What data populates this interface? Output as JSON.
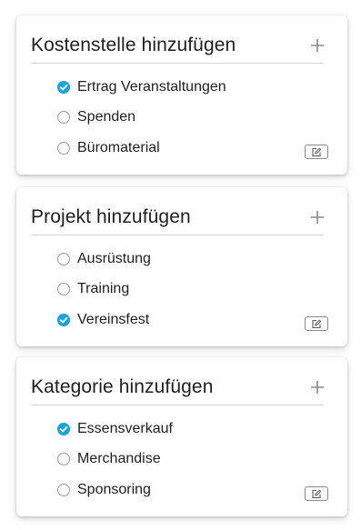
{
  "colors": {
    "accent": "#1aa3d9",
    "text": "#1f1f1f",
    "divider": "#d6d6d6",
    "icon": "#8a8a8a"
  },
  "icons": {
    "add": "plus-icon",
    "edit": "edit-icon",
    "checked": "check-icon"
  },
  "cards": [
    {
      "title": "Kostenstelle hinzufügen",
      "options": [
        {
          "label": "Ertrag Veranstaltungen",
          "checked": true
        },
        {
          "label": "Spenden",
          "checked": false
        },
        {
          "label": "Büromaterial",
          "checked": false
        }
      ]
    },
    {
      "title": "Projekt hinzufügen",
      "options": [
        {
          "label": "Ausrüstung",
          "checked": false
        },
        {
          "label": "Training",
          "checked": false
        },
        {
          "label": "Vereinsfest",
          "checked": true
        }
      ]
    },
    {
      "title": "Kategorie hinzufügen",
      "options": [
        {
          "label": "Essensverkauf",
          "checked": true
        },
        {
          "label": "Merchandise",
          "checked": false
        },
        {
          "label": "Sponsoring",
          "checked": false
        }
      ]
    }
  ]
}
